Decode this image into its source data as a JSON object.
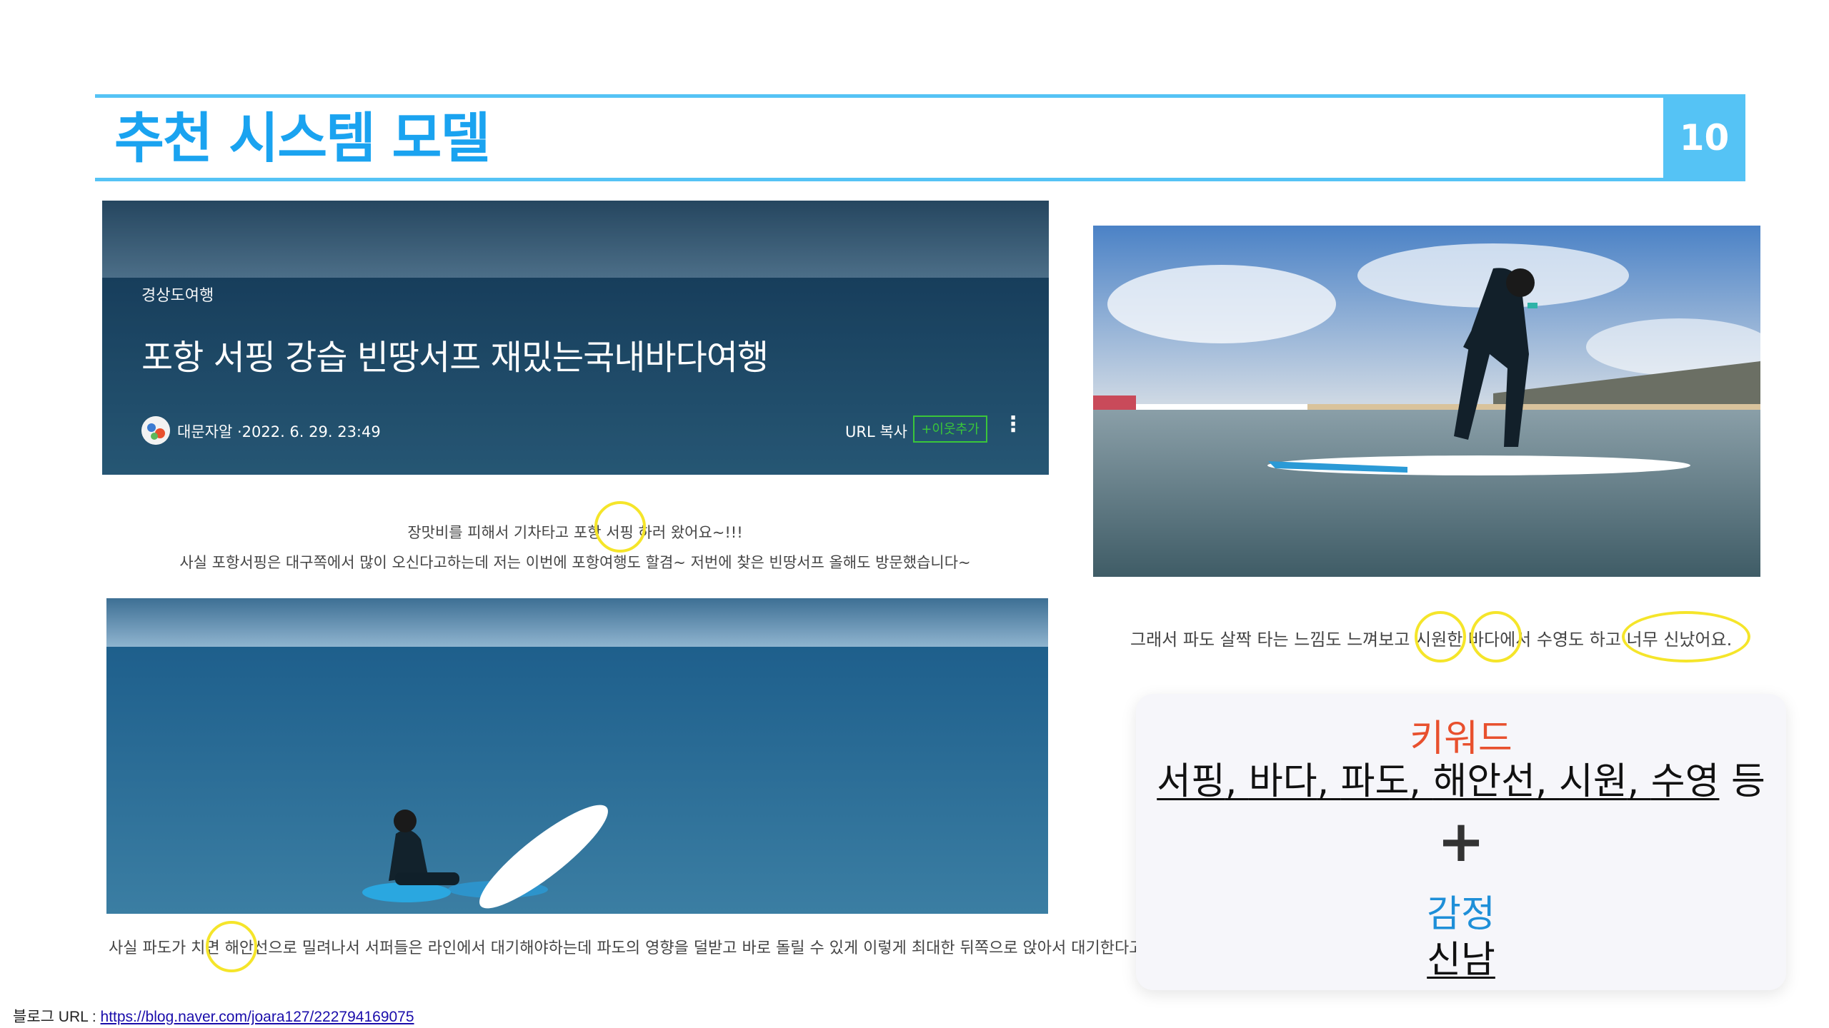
{
  "slide": {
    "title": "추천 시스템 모델",
    "page_number": "10"
  },
  "blog_header": {
    "category": "경상도여행",
    "title": "포항 서핑 강습 빈땅서프 재밌는국내바다여행",
    "author_date": "대문자알 ·2022. 6. 29. 23:49",
    "url_copy": "URL 복사",
    "neighbor_button": "+이웃추가",
    "more_icon": "⋮"
  },
  "captions": {
    "line1": "장맛비를 피해서 기차타고 포항 서핑 하러 왔어요~!!!",
    "line2": "사실 포항서핑은 대구쪽에서 많이 오신다고하는데 저는 이번에 포항여행도 할겸~ 저번에 찾은 빈땅서프 올해도 방문했습니다~",
    "line3": "사실 파도가 치면 해안선으로 밀려나서 서퍼들은 라인에서 대기해야하는데 파도의 영향을 덜받고 바로 돌릴 수 있게 이렇게 최대한 뒤쪽으로 앉아서 대기한다고해요.",
    "line4": "그래서 파도 살짝 타는 느낌도 느껴보고 시원한 바다에서 수영도 하고 너무 신났어요."
  },
  "keyword_card": {
    "keyword_title": "키워드",
    "keywords": [
      "서핑",
      "바다",
      "파도",
      "해안선",
      "시원",
      "수영"
    ],
    "keywords_suffix": "등",
    "plus": "+",
    "emotion_title": "감정",
    "emotion_value": "신남"
  },
  "footer": {
    "label": "블로그 URL : ",
    "url": "https://blog.naver.com/joara127/222794169075"
  },
  "colors": {
    "accent_blue": "#55c3f5",
    "title_blue": "#1aa3f0",
    "keyword_orange": "#e8502e",
    "emotion_blue": "#1e8fd8",
    "highlight_yellow": "#f5e52a"
  }
}
